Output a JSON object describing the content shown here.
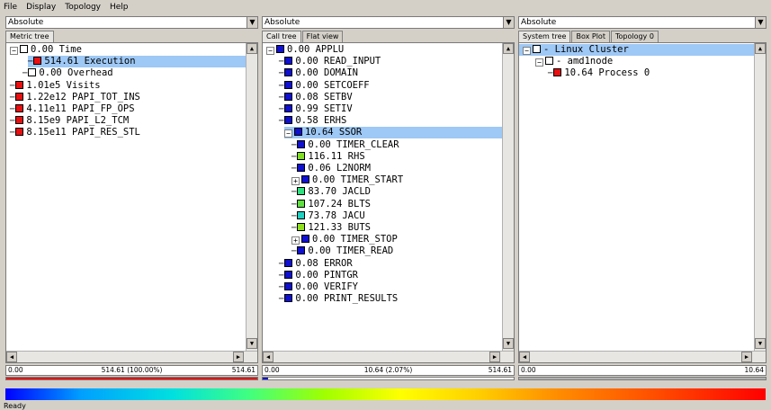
{
  "menu": [
    "File",
    "Display",
    "Topology",
    "Help"
  ],
  "panels": [
    {
      "combo": "Absolute",
      "tabs": [
        "Metric tree"
      ],
      "rows": [
        {
          "label": "0.00 Time",
          "color": "#ffffff",
          "indent": 0,
          "expander": "-"
        },
        {
          "label": "514.61 Execution",
          "color": "#e81010",
          "indent": 1,
          "selected": true
        },
        {
          "label": "0.00 Overhead",
          "color": "#ffffff",
          "indent": 1
        },
        {
          "label": "1.01e5 Visits",
          "color": "#e81010",
          "indent": 0
        },
        {
          "label": "1.22e12 PAPI_TOT_INS",
          "color": "#e81010",
          "indent": 0
        },
        {
          "label": "4.11e11 PAPI_FP_OPS",
          "color": "#e81010",
          "indent": 0
        },
        {
          "label": "8.15e9 PAPI_L2_TCM",
          "color": "#e81010",
          "indent": 0
        },
        {
          "label": "8.15e11 PAPI_RES_STL",
          "color": "#e81010",
          "indent": 0
        }
      ],
      "scale": {
        "lo": "0.00",
        "mid": "514.61 (100.00%)",
        "hi": "514.61",
        "fill": 1.0,
        "fill_color": "#e81010"
      }
    },
    {
      "combo": "Absolute",
      "tabs": [
        "Call tree",
        "Flat view"
      ],
      "rows": [
        {
          "label": "0.00 APPLU",
          "color": "#1010d0",
          "indent": 0,
          "expander": "-"
        },
        {
          "label": "0.00 READ_INPUT",
          "color": "#1010d0",
          "indent": 1
        },
        {
          "label": "0.00 DOMAIN",
          "color": "#1010d0",
          "indent": 1
        },
        {
          "label": "0.00 SETCOEFF",
          "color": "#1010d0",
          "indent": 1
        },
        {
          "label": "0.08 SETBV",
          "color": "#1010d0",
          "indent": 1
        },
        {
          "label": "0.99 SETIV",
          "color": "#1010d0",
          "indent": 1
        },
        {
          "label": "0.58 ERHS",
          "color": "#1010d0",
          "indent": 1
        },
        {
          "label": "10.64 SSOR",
          "color": "#1010d0",
          "indent": 1,
          "expander": "-",
          "selected": true
        },
        {
          "label": "0.00 TIMER_CLEAR",
          "color": "#1010d0",
          "indent": 2
        },
        {
          "label": "116.11 RHS",
          "color": "#80e020",
          "indent": 2
        },
        {
          "label": "0.06 L2NORM",
          "color": "#1010d0",
          "indent": 2
        },
        {
          "label": "0.00 TIMER_START",
          "color": "#1010d0",
          "indent": 2,
          "expander": "+"
        },
        {
          "label": "83.70 JACLD",
          "color": "#30e080",
          "indent": 2
        },
        {
          "label": "107.24 BLTS",
          "color": "#60e040",
          "indent": 2
        },
        {
          "label": "73.78 JACU",
          "color": "#20d0c0",
          "indent": 2
        },
        {
          "label": "121.33 BUTS",
          "color": "#90e020",
          "indent": 2
        },
        {
          "label": "0.00 TIMER_STOP",
          "color": "#1010d0",
          "indent": 2,
          "expander": "+"
        },
        {
          "label": "0.00 TIMER_READ",
          "color": "#1010d0",
          "indent": 2
        },
        {
          "label": "0.08 ERROR",
          "color": "#1010d0",
          "indent": 1
        },
        {
          "label": "0.00 PINTGR",
          "color": "#1010d0",
          "indent": 1
        },
        {
          "label": "0.00 VERIFY",
          "color": "#1010d0",
          "indent": 1
        },
        {
          "label": "0.00 PRINT_RESULTS",
          "color": "#1010d0",
          "indent": 1
        }
      ],
      "scale": {
        "lo": "0.00",
        "mid": "10.64 (2.07%)",
        "hi": "514.61",
        "fill": 0.0207,
        "fill_color": "#1010d0"
      }
    },
    {
      "combo": "Absolute",
      "tabs": [
        "System tree",
        "Box Plot",
        "Topology 0"
      ],
      "rows": [
        {
          "label": "- Linux Cluster",
          "color": "#ffffff",
          "indent": 0,
          "expander": "-",
          "selected": true
        },
        {
          "label": "- amd1node",
          "color": "#ffffff",
          "indent": 1,
          "expander": "-"
        },
        {
          "label": "10.64 Process 0",
          "color": "#e81010",
          "indent": 2
        }
      ],
      "scale": {
        "lo": "0.00",
        "mid": "",
        "hi": "10.64",
        "fill": 1.0,
        "fill_color": "#b0b0b0"
      }
    }
  ],
  "status": "Ready"
}
